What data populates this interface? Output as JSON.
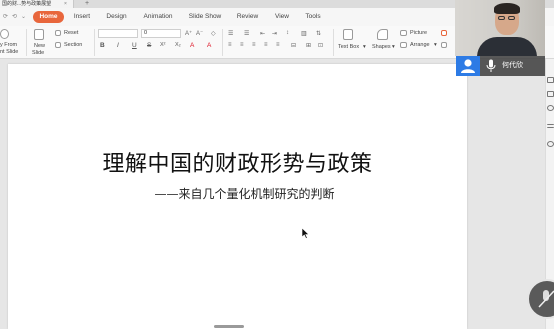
{
  "titlebar": {
    "doc_tab": "国的财...势与政策展望",
    "tab_close": "×",
    "tab_add": "+"
  },
  "menu": {
    "items": [
      "Home",
      "Insert",
      "Design",
      "Animation",
      "Slide Show",
      "Review",
      "View",
      "Tools"
    ],
    "active": "Home"
  },
  "ribbon": {
    "from_label_1": "y From",
    "from_label_2": "nt Slide",
    "new_slide_1": "New",
    "new_slide_2": "Slide",
    "reset": "Reset",
    "section": "Section",
    "font_size": "0",
    "bold": "B",
    "italic": "I",
    "underline": "U",
    "strike": "S",
    "superscript": "X²",
    "subscript": "X₂",
    "text_box": "Text Box",
    "shapes": "Shapes",
    "picture": "Picture",
    "arrange": "Arrange"
  },
  "slide": {
    "title": "理解中国的财政形势与政策",
    "subtitle": "——来自几个量化机制研究的判断"
  },
  "video": {
    "participant_name": "何代欣"
  },
  "colors": {
    "accent": "#e8663c",
    "avatar_badge": "#2d7be5"
  }
}
